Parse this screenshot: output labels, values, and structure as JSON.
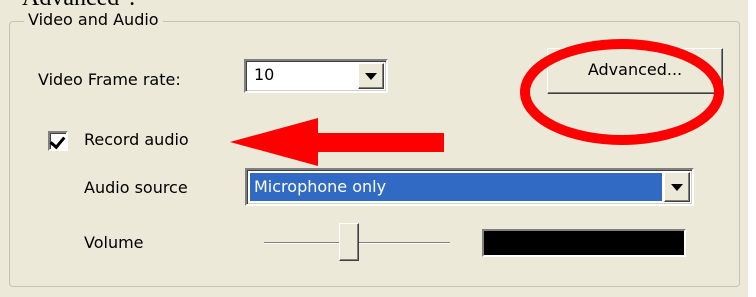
{
  "caption": "Advanced\".",
  "group": {
    "title": "Video and Audio",
    "frame_rate_label": "Video Frame rate:",
    "frame_rate_value": "10",
    "advanced_button": "Advanced...",
    "record_audio_label": "Record audio",
    "record_audio_checked": true,
    "audio_source_label": "Audio source",
    "audio_source_value": "Microphone only",
    "volume_label": "Volume",
    "volume_level": 0.45
  },
  "colors": {
    "annotation_red": "#ff0000",
    "selection_blue": "#316ac5",
    "panel_bg": "#ece9d8"
  },
  "icons": {
    "frame_rate_dropdown": "chevron-down-icon",
    "audio_source_dropdown": "chevron-down-icon",
    "checkbox": "check-icon",
    "annotation_arrow": "arrow-left-icon",
    "annotation_ellipse": "ellipse-highlight"
  }
}
